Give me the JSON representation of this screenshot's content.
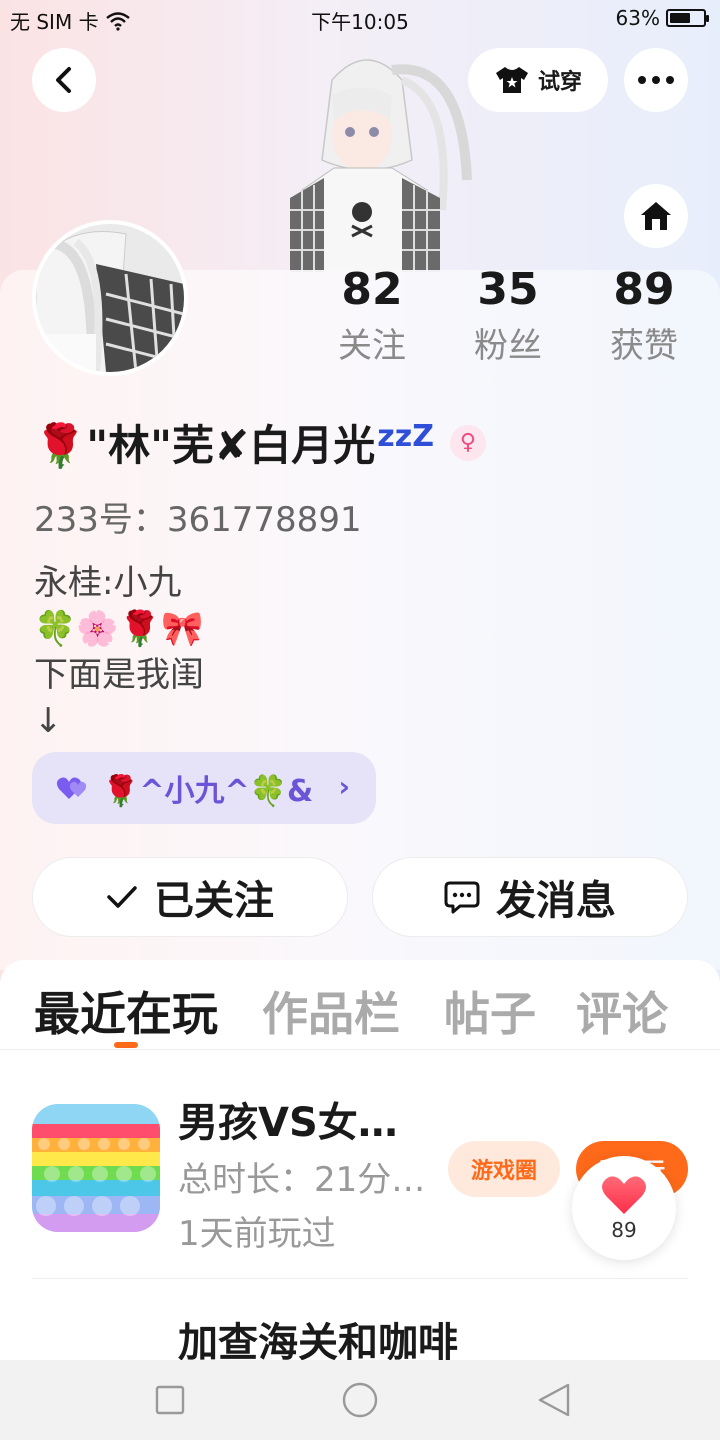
{
  "status_bar": {
    "carrier": "无 SIM 卡",
    "time": "下午10:05",
    "battery": "63%",
    "battery_level": 0.63
  },
  "header": {
    "try_on_label": "试穿",
    "icons": [
      "back-icon",
      "tshirt-icon",
      "more-icon",
      "home-icon"
    ]
  },
  "stats": {
    "following": {
      "value": "82",
      "label": "关注"
    },
    "followers": {
      "value": "35",
      "label": "粉丝"
    },
    "likes": {
      "value": "89",
      "label": "获赞"
    }
  },
  "profile": {
    "nickname": "🌹\"林\"芜✘白月光",
    "nickname_suffix": "zzZ",
    "gender_icon": "female-icon",
    "id_line": "233号：361778891",
    "bio": [
      "永桂:小九",
      "🍀🌸🌹🎀",
      "下面是我闺",
      "↓"
    ]
  },
  "cp_chip": {
    "label": "🌹^小九^🍀&",
    "icon": "double-heart-icon"
  },
  "actions": {
    "follow_label": "已关注",
    "message_label": "发消息"
  },
  "tabs": [
    "最近在玩",
    "作品栏",
    "帖子",
    "评论"
  ],
  "active_tab": 0,
  "games": [
    {
      "title": "男孩VS女…",
      "duration": "总时长：21分…",
      "last_played": "1天前玩过",
      "circle_label": "游戏圈",
      "play_label": "开始玩"
    },
    {
      "title": "加查海关和咖啡"
    }
  ],
  "like_float": {
    "count": "89"
  },
  "colors": {
    "accent": "#ff6a1a",
    "chip_bg": "#e6e2f8",
    "chip_text": "#6b55d6",
    "heart": "#ff3b4f"
  }
}
